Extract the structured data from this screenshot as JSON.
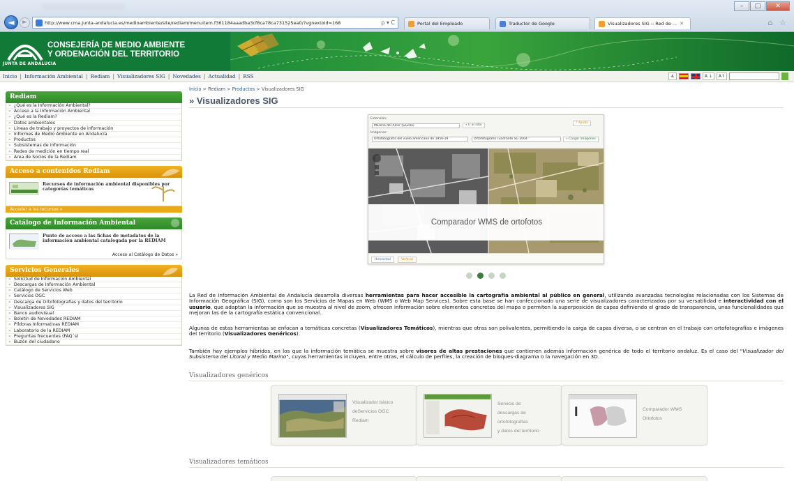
{
  "browser": {
    "url": "http://www.cma.junta-andalucia.es/medioambiente/site/rediam/menuitem.f361184aaadba3cf8ca78ca731525ea0/?vgnextoid=168",
    "address_icons": "ρ ▾ C",
    "tabs": [
      {
        "label": "Portal del Empleado",
        "color": "#f0a030"
      },
      {
        "label": "Traductor de Google",
        "color": "#4a7fd8"
      },
      {
        "label": "Visualizadores SIG :: Red de ...",
        "close": "✕",
        "color": "#f0a030"
      }
    ],
    "window_buttons": [
      "–",
      "□",
      "✕"
    ],
    "home_icons": "⌂ ☆"
  },
  "banner": {
    "org_line1": "CONSEJERÍA DE MEDIO AMBIENTE",
    "org_line2": "Y ORDENACIÓN DEL TERRITORIO",
    "junta": "JUNTA DE ANDALUCIA",
    "colors": {
      "green": "#117a37",
      "accent": "#6db33f"
    }
  },
  "topmenu": {
    "items": [
      "Inicio",
      "Información Ambiental",
      "Rediam",
      "Visualizadores SIG",
      "Novedades",
      "Actualidad",
      "RSS"
    ],
    "separator": "|",
    "tools": [
      "♿",
      "A ↓",
      "A↑"
    ]
  },
  "sidebar": {
    "rediam": {
      "title": "Rediam",
      "items": [
        "¿Qué es la Información Ambiental?",
        "Acceso a la Información Ambiental",
        "¿Qué es la Rediam?",
        "Datos ambientales",
        "Líneas de trabajo y proyectos de información",
        "Informes de Medio Ambiente en Andalucía",
        "Productos",
        "Subsistemas de información",
        "Redes de medición en tiempo real",
        "Área de Socios de la Rediam"
      ]
    },
    "acceso": {
      "title": "Acceso a contenidos Rediam",
      "text": "Recursos de información ambiental disponibles por categorías temáticas",
      "footer": "Acceder a los recursos »"
    },
    "catalogo": {
      "title": "Catálogo de Información Ambiental",
      "text": "Punto de acceso a las fichas de metadatos de la información ambiental catalogada por la REDIAM",
      "link": "Acceso al Catálogo de Datos »"
    },
    "servicios": {
      "title": "Servicios Generales",
      "items": [
        "Solicitud de Información Ambiental",
        "Descargas de Información Ambiental",
        "Catálogo de Servicios Web",
        "Servicios OGC",
        "Descarga de Ortofotografías y datos del territorio",
        "Visualizadores SIG",
        "Banco audiovisual",
        "Boletín de Novedades REDIAM",
        "Píldoras Informativas REDIAM",
        "Laboratorio de la REDIAM",
        "Preguntas frecuentes (FAQ´s)",
        "Buzón del ciudadano"
      ]
    },
    "bullet": "»"
  },
  "main": {
    "breadcrumb": [
      "Inicio",
      "Rediam",
      "Productos",
      "Visualizadores SIG"
    ],
    "breadcrumb_sep": " > ",
    "title": "» Visualizadores SIG",
    "hero": {
      "extension_label": "Extensión:",
      "extension_value": "Marena del Alcor (Sevilla)",
      "go_button": "» Ir al sitio",
      "help_button": "? Ayuda",
      "images_label": "Imágenes:",
      "image1": "Ortofotografía del vuelo americano de 1956-19",
      "image2": "Ortofotografía cuadrante SG 2004",
      "load_button": "» Cargar imágenes",
      "caption": "Comparador WMS de ortofotos",
      "mode_horizontal": "Horizontal",
      "mode_vertical": "Vertical"
    },
    "carousel": {
      "count": 4,
      "active": 1
    },
    "p1": {
      "a": "La Red de Información Ambiental de Andalucía desarrolla diversas ",
      "b": "herramientas para hacer accesible la cartografía ambiental al público en general",
      "c": ", utilizando avanzadas tecnologías relacionadas con los Sistemas de Información Geográfica (SIG), como son los Servicios de Mapas en Web (WMS o Web Map Services). Sobre esta base se han confeccionado una serie de visualizadores caracterizados por su versatilidad e ",
      "d": "interactividad con el usuario",
      "e": ", que adaptan la información que se muestra al nivel de zoom, ofrecen información sobre elementos concretos del mapa o permiten la superposición de capas definiendo el grado de transparencia, unas funcionalidades que mejoran las de la cartografía estática convencional."
    },
    "p2": {
      "a": "Algunas de estas herramientas se enfocan a temáticas concretas (",
      "b": "Visualizadores Temáticos",
      "c": "), mientras que otras son polivalentes, permitiendo la carga de capas diversa, o se centran en el trabajo con ortofotografías e imágenes del territorio (",
      "d": "Visualizadores Genéricos",
      "e": ")."
    },
    "p3": {
      "a": "También hay ejemplos híbridos, en los que la información temática se muestra sobre ",
      "b": "visores de altas prestaciones",
      "c": " que contienen además información genérica de todo el territorio andaluz. Es el caso del \"",
      "d": "Visualizador del Subsistema del Litoral y Medio Marino",
      "e": "\", cuyas herramientas incluyen, entre otras, el cálculo de perfiles, la creación de bloques-diagrama o la navegación en 3D."
    },
    "section_genericos": "Visualizadores genéricos",
    "section_tematicos": "Visualizadores temáticos",
    "cards": [
      {
        "l1": "Visualizador básico",
        "l2": "deServicios OGC",
        "l3": "Rediam"
      },
      {
        "l1": "Servicio de",
        "l2": "descargas de",
        "l3": "ortofotografías",
        "l4": "y datos del territorio"
      },
      {
        "l1": "Comparador WMS",
        "l2": "Ortofotos"
      }
    ]
  }
}
